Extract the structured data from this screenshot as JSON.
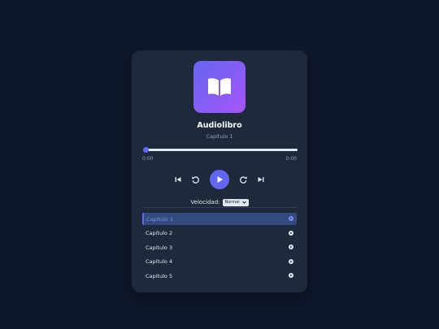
{
  "player": {
    "title": "Audiolibro",
    "current_chapter": "Capítulo 1",
    "progress": 0,
    "time_current": "0:00",
    "time_total": "0:00",
    "speed_label": "Velocidad:",
    "speed_value": "Normal"
  },
  "controls": {
    "previous_icon": "skip-previous-icon",
    "rewind_icon": "rewind-icon",
    "play_icon": "play-icon",
    "forward_icon": "forward-icon",
    "next_icon": "skip-next-icon"
  },
  "chapters": [
    {
      "label": "Capítulo 1",
      "active": true
    },
    {
      "label": "Capítulo 2",
      "active": false
    },
    {
      "label": "Capítulo 3",
      "active": false
    },
    {
      "label": "Capítulo 4",
      "active": false
    },
    {
      "label": "Capítulo 5",
      "active": false
    }
  ],
  "colors": {
    "background": "#0f172a",
    "card": "#1e293b",
    "accent": "#6366f1",
    "accent_light": "#818cf8",
    "cover_gradient_end": "#a855f7",
    "text": "#e2e8f0",
    "muted": "#94a3b8",
    "active_row": "#334a7d"
  }
}
